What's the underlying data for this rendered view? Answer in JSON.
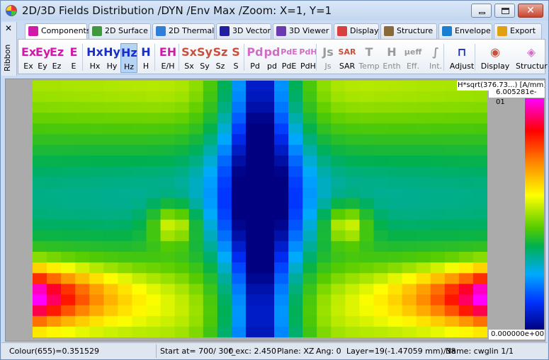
{
  "window": {
    "title": "2D/3D Fields Distribution /DYN /Env Max /Zoom: X=1, Y=1",
    "close_glyph": "✕"
  },
  "ribbon": {
    "side_label": "Ribbon",
    "close_glyph": "✕",
    "tabs": [
      {
        "label": "Components",
        "icon": "e-component-icon",
        "active": true
      },
      {
        "label": "2D Surface",
        "icon": "surface-icon"
      },
      {
        "label": "2D Thermal",
        "icon": "thermal-icon"
      },
      {
        "label": "3D Vector",
        "icon": "vector-icon"
      },
      {
        "label": "3D Viewer",
        "icon": "viewer-icon"
      },
      {
        "label": "Display",
        "icon": "display-icon"
      },
      {
        "label": "Structure",
        "icon": "structure-icon"
      },
      {
        "label": "Envelope",
        "icon": "envelope-icon"
      },
      {
        "label": "Export",
        "icon": "export-icon"
      }
    ],
    "tools": [
      {
        "icon": "Ex",
        "label": "Ex"
      },
      {
        "icon": "Ey",
        "label": "Ey"
      },
      {
        "icon": "Ez",
        "label": "Ez"
      },
      {
        "icon": "E",
        "label": "E"
      },
      {
        "icon": "Hx",
        "label": "Hx"
      },
      {
        "icon": "Hy",
        "label": "Hy"
      },
      {
        "icon": "Hz",
        "label": "Hz",
        "selected": true
      },
      {
        "icon": "H",
        "label": "H"
      },
      {
        "icon": "EH",
        "label": "E/H"
      },
      {
        "icon": "Sx",
        "label": "Sx"
      },
      {
        "icon": "Sy",
        "label": "Sy"
      },
      {
        "icon": "Sz",
        "label": "Sz"
      },
      {
        "icon": "S",
        "label": "S"
      },
      {
        "icon": "Pd",
        "label": "Pd"
      },
      {
        "icon": "pd",
        "label": "pd"
      },
      {
        "icon": "PdE",
        "label": "PdE"
      },
      {
        "icon": "PdH",
        "label": "PdH"
      },
      {
        "icon": "Js",
        "label": "Js"
      },
      {
        "icon": "SAR",
        "label": "SAR"
      },
      {
        "icon": "T",
        "label": "Temp"
      },
      {
        "icon": "H",
        "label": "Enth"
      },
      {
        "icon": "μeff",
        "label": "Eff."
      },
      {
        "icon": "∫",
        "label": "Int."
      },
      {
        "icon": "⊓",
        "label": "Adjust"
      },
      {
        "icon": "◉",
        "label": "Display"
      },
      {
        "icon": "◈",
        "label": "Structur"
      }
    ],
    "colors": {
      "e_group": "#d21aa8",
      "h_group": "#1a2fc8",
      "s_group": "#c8503c",
      "pd_group": "#d26ac8",
      "disabled": "#9a9a9a"
    }
  },
  "plot": {
    "scale_title": "H*sqrt(376.73...) [A/mm]",
    "scale_max": "6.005281e-01",
    "scale_min": "0.000000e+00"
  },
  "status": {
    "colour": "Colour(655)=0.351529",
    "start": "Start at= 700/ 300",
    "f_exc": "f_exc:  2.450",
    "plane": "Plane: XZ",
    "ang": "Ang:   0",
    "layer": "Layer=19(-1.47059 mm)/38",
    "name": "Name: cwglin 1/1"
  }
}
